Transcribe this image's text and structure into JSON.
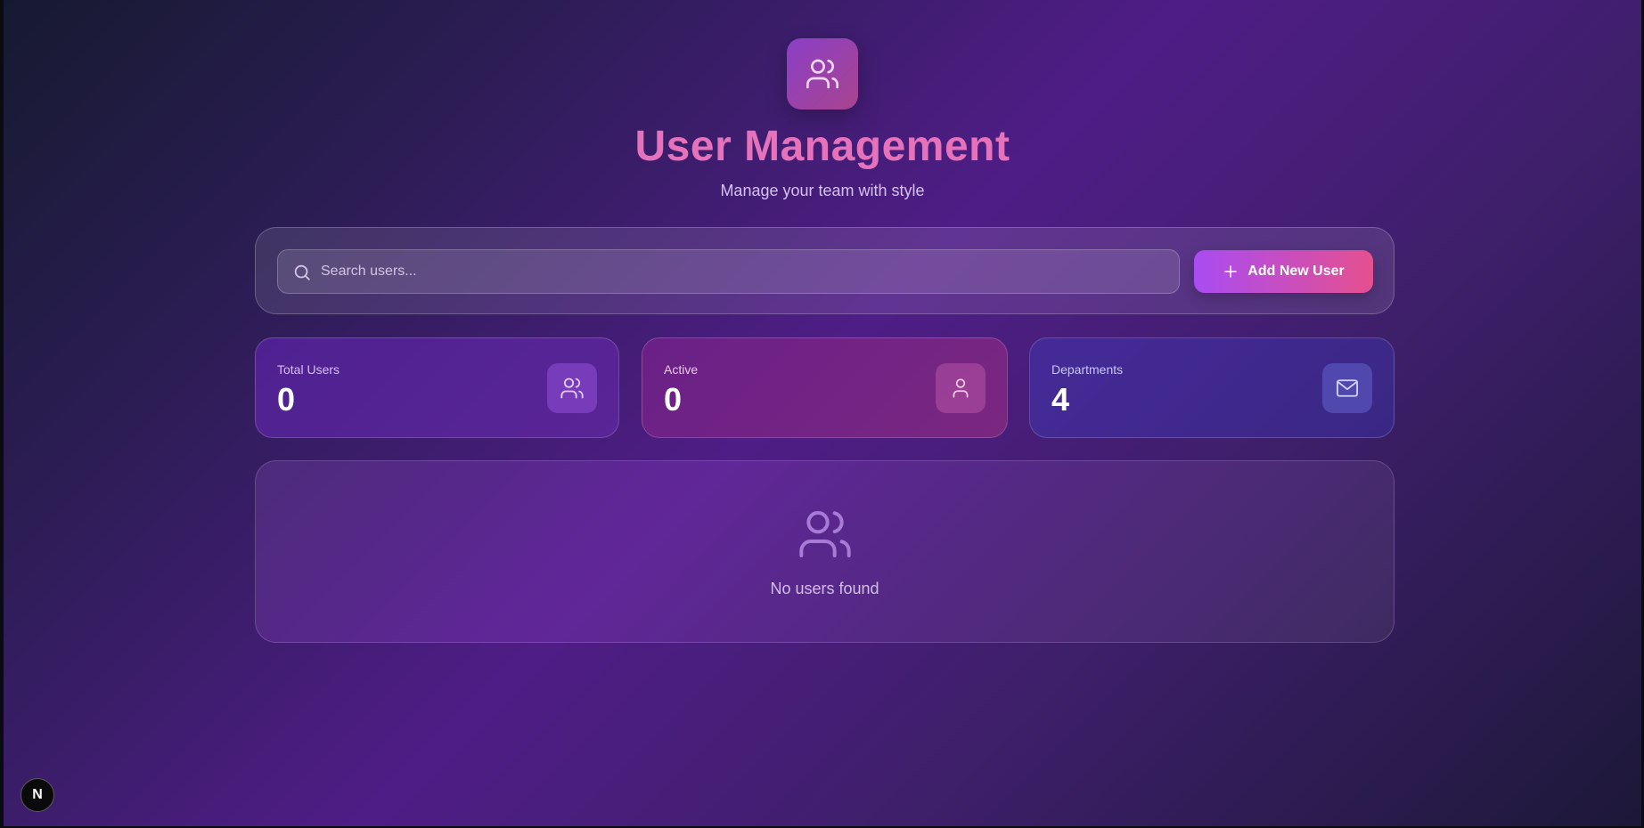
{
  "header": {
    "logo_icon": "users-icon",
    "title": "User Management",
    "subtitle": "Manage your team with style"
  },
  "toolbar": {
    "search": {
      "placeholder": "Search users...",
      "value": "",
      "icon": "search-icon"
    },
    "add_button": {
      "label": "Add New User",
      "icon": "plus-icon"
    }
  },
  "stats": [
    {
      "label": "Total Users",
      "value": "0",
      "icon": "users-icon"
    },
    {
      "label": "Active",
      "value": "0",
      "icon": "user-icon"
    },
    {
      "label": "Departments",
      "value": "4",
      "icon": "mail-icon"
    }
  ],
  "empty_state": {
    "icon": "users-icon",
    "message": "No users found"
  },
  "corner_badge": {
    "label": "N"
  },
  "colors": {
    "title": "#e672bc",
    "button_start": "#a94cf2",
    "button_end": "#e5508f"
  }
}
